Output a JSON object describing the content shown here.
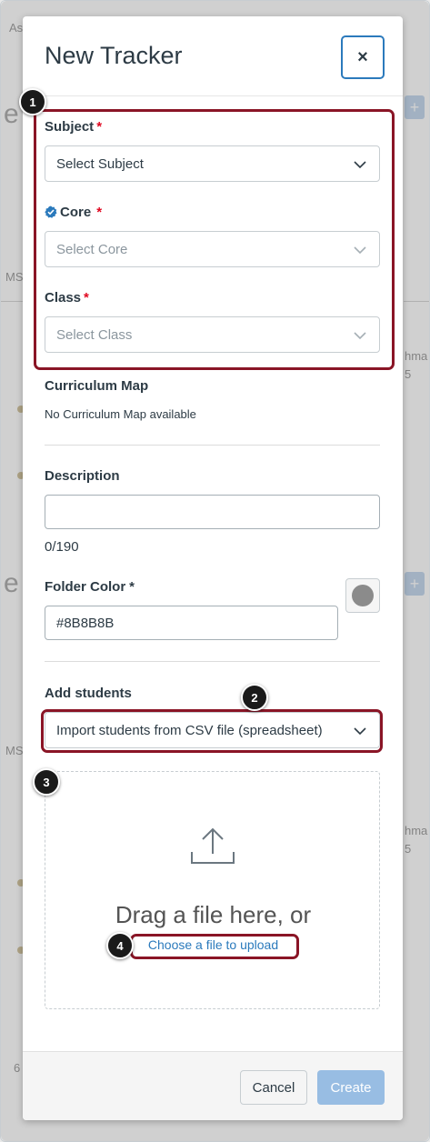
{
  "background": {
    "fragments": [
      "As",
      "e",
      "MS",
      "e",
      "MS",
      "6"
    ],
    "side_fragments": [
      "hma",
      "5",
      "hma",
      "5"
    ]
  },
  "modal": {
    "title": "New Tracker",
    "close_label": "×",
    "subject": {
      "label": "Subject",
      "required_mark": "*",
      "value": "Select Subject"
    },
    "core": {
      "label": "Core",
      "required_mark": "*",
      "value": "Select Core"
    },
    "class": {
      "label": "Class",
      "required_mark": "*",
      "value": "Select Class"
    },
    "curriculum": {
      "label": "Curriculum Map",
      "value": "No Curriculum Map available"
    },
    "description": {
      "label": "Description",
      "value": "",
      "counter": "0/190"
    },
    "folder_color": {
      "label": "Folder Color",
      "required_mark": "*",
      "value": "#8B8B8B"
    },
    "add_students": {
      "label": "Add students",
      "value": "Import students from CSV file (spreadsheet)"
    },
    "upload": {
      "drag_text": "Drag a file here, or",
      "choose_link": "Choose a file to upload"
    },
    "footer": {
      "cancel_label": "Cancel",
      "create_label": "Create"
    }
  },
  "annotations": [
    "1",
    "2",
    "3",
    "4"
  ],
  "colors": {
    "highlight": "#8a1526",
    "link": "#2b7abc",
    "required": "#e0061f",
    "create_disabled": "#98bde3",
    "swatch": "#8B8B8B"
  },
  "icons": [
    "close-icon",
    "chevron-down-icon",
    "verified-icon",
    "upload-icon",
    "color-swatch-icon"
  ]
}
